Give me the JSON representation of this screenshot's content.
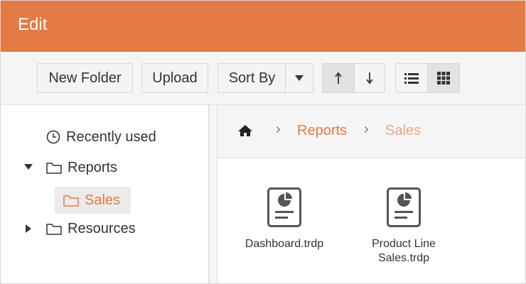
{
  "window": {
    "title": "Edit"
  },
  "toolbar": {
    "new_folder_label": "New Folder",
    "upload_label": "Upload",
    "sort_by_label": "Sort By"
  },
  "tree": {
    "items": [
      {
        "label": "Recently used",
        "icon": "clock-icon"
      },
      {
        "label": "Reports",
        "icon": "folder-icon",
        "expanded": true
      },
      {
        "label": "Sales",
        "icon": "folder-icon",
        "selected": true
      },
      {
        "label": "Resources",
        "icon": "folder-icon",
        "expanded": false
      }
    ]
  },
  "breadcrumb": {
    "home_icon": "home-icon",
    "items": [
      "Reports",
      "Sales"
    ]
  },
  "files": [
    {
      "name": "Dashboard.trdp",
      "icon": "report-file-icon"
    },
    {
      "name": "Product Line Sales.trdp",
      "icon": "report-file-icon"
    }
  ],
  "colors": {
    "accent": "#e47a45",
    "accent_light": "#f0a882",
    "toolbar_bg": "#f5f5f5"
  }
}
